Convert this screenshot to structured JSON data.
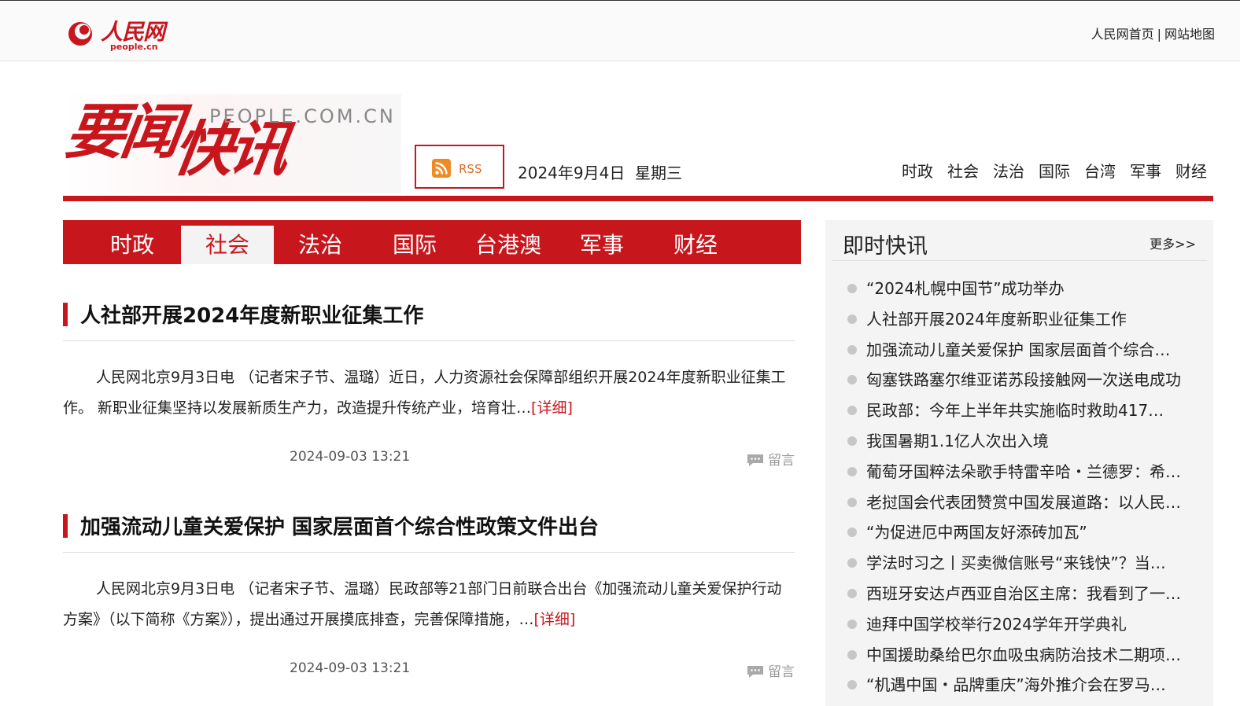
{
  "topbar": {
    "logo_cn": "人民网",
    "logo_en": "people.cn",
    "links": [
      "人民网首页",
      "网站地图"
    ],
    "separator": "|"
  },
  "banner": {
    "title_part1": "要闻",
    "title_part2": "快讯",
    "domain": "PEOPLE.COM.CN",
    "rss_label": "RSS",
    "date": "2024年9月4日  星期三",
    "nav": [
      "时政",
      "社会",
      "法治",
      "国际",
      "台湾",
      "军事",
      "财经"
    ]
  },
  "mainnav": {
    "tabs": [
      "时政",
      "社会",
      "法治",
      "国际",
      "台港澳",
      "军事",
      "财经"
    ],
    "active": "社会"
  },
  "articles": [
    {
      "title": "人社部开展2024年度新职业征集工作",
      "body": "人民网北京9月3日电 （记者宋子节、温璐）近日，人力资源社会保障部组织开展2024年度新职业征集工作。 新职业征集坚持以发展新质生产力，改造提升传统产业，培育壮…",
      "more": "[详细]",
      "time": "2024-09-03 13:21",
      "comment": "留言"
    },
    {
      "title": "加强流动儿童关爱保护 国家层面首个综合性政策文件出台",
      "body": "人民网北京9月3日电 （记者宋子节、温璐）民政部等21部门日前联合出台《加强流动儿童关爱保护行动方案》（以下简称《方案》），提出通过开展摸底排查，完善保障措施，…",
      "more": "[详细]",
      "time": "2024-09-03 13:21",
      "comment": "留言"
    }
  ],
  "sidebar": {
    "title": "即时快讯",
    "more": "更多>>",
    "items": [
      "“2024札幌中国节”成功举办",
      "人社部开展2024年度新职业征集工作",
      "加强流动儿童关爱保护 国家层面首个综合…",
      "匈塞铁路塞尔维亚诺苏段接触网一次送电成功",
      "民政部：今年上半年共实施临时救助417…",
      "我国暑期1.1亿人次出入境",
      "葡萄牙国粹法朵歌手特雷辛哈・兰德罗：希…",
      "老挝国会代表团赞赏中国发展道路：以人民…",
      "“为促进厄中两国友好添砖加瓦”",
      "学法时习之丨买卖微信账号“来钱快”？当…",
      "西班牙安达卢西亚自治区主席：我看到了一…",
      "迪拜中国学校举行2024学年开学典礼",
      "中国援助桑给巴尔血吸虫病防治技术二期项…",
      "“机遇中国・品牌重庆”海外推介会在罗马…"
    ]
  },
  "colors": {
    "brand_red": "#c8161d",
    "rss_orange": "#f08a24"
  }
}
